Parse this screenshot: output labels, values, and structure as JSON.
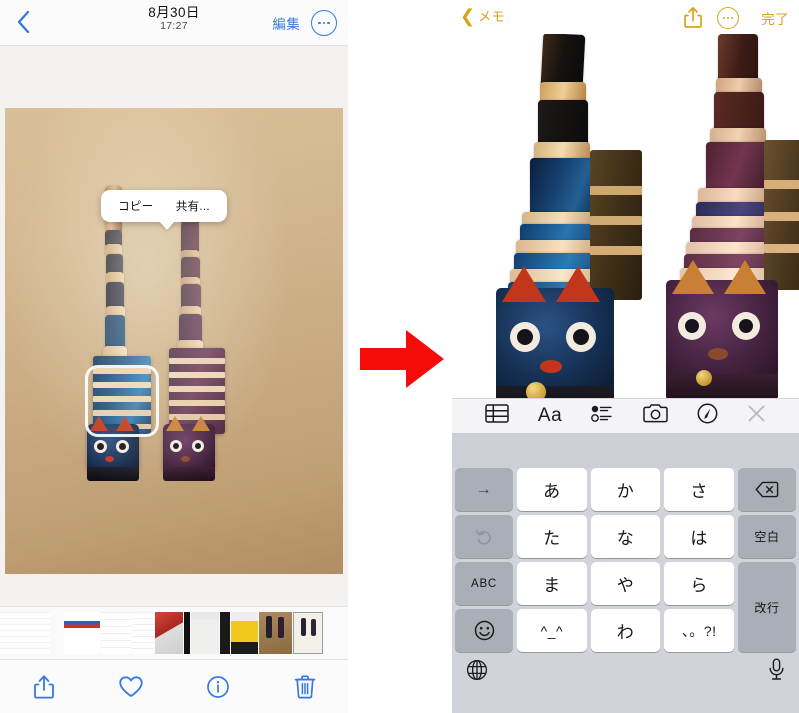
{
  "meta": {
    "description": "Two iPhone screenshots side by side showing copying a photo subject in Photos and pasting it into Notes",
    "accent_blue": "#3478e8",
    "accent_gold": "#d9a21b",
    "arrow_color": "#f60b0b"
  },
  "left_phone": {
    "navbar": {
      "back_icon": "chevron-left-icon",
      "date": "8月30日",
      "time": "17:27",
      "edit_label": "編集",
      "more_icon": "ellipsis-circle-icon"
    },
    "photo": {
      "alt": "Two striped wooden cat figurines standing on a light wood floor",
      "callout": {
        "copy_label": "コピー",
        "share_label": "共有..."
      }
    },
    "filmstrip": {
      "thumbnails": [
        {
          "name": "thumb-notes-grid"
        },
        {
          "name": "thumb-document-white"
        },
        {
          "name": "thumb-chart-red-blue"
        },
        {
          "name": "thumb-list-white"
        },
        {
          "name": "thumb-red-jacket"
        },
        {
          "name": "thumb-white-wall"
        },
        {
          "name": "thumb-yellow-jacket"
        },
        {
          "name": "thumb-cats-photo"
        },
        {
          "name": "thumb-cats-photo-selected"
        }
      ]
    },
    "tabbar": {
      "items": [
        {
          "name": "share-icon",
          "label": "share"
        },
        {
          "name": "heart-icon",
          "label": "favorite"
        },
        {
          "name": "info-icon",
          "label": "info"
        },
        {
          "name": "trash-icon",
          "label": "delete"
        }
      ]
    }
  },
  "right_phone": {
    "navbar": {
      "back_icon": "chevron-left-icon",
      "back_label": "メモ",
      "share_icon": "share-icon",
      "more_icon": "ellipsis-circle-icon",
      "done_label": "完了"
    },
    "note": {
      "alt": "The two wooden cat figurines cut out from their background on white",
      "caret_visible": true
    },
    "keyboard": {
      "toolbar": [
        {
          "name": "table-icon",
          "label": "table"
        },
        {
          "name": "text-format-icon",
          "label": "Aa"
        },
        {
          "name": "checklist-icon",
          "label": "checklist"
        },
        {
          "name": "camera-icon",
          "label": "camera"
        },
        {
          "name": "markup-pen-icon",
          "label": "markup"
        },
        {
          "name": "close-icon",
          "label": "close"
        }
      ],
      "suggestions": [],
      "rows": [
        [
          {
            "label": "→",
            "style": "grey",
            "kind": "fn",
            "name": "cursor-right-key"
          },
          {
            "label": "あ",
            "style": "white",
            "kind": "kana",
            "name": "key-a"
          },
          {
            "label": "か",
            "style": "white",
            "kind": "kana",
            "name": "key-ka"
          },
          {
            "label": "さ",
            "style": "white",
            "kind": "kana",
            "name": "key-sa"
          },
          {
            "label": "⌫",
            "style": "grey",
            "kind": "fn",
            "name": "backspace-key"
          }
        ],
        [
          {
            "label": "↺",
            "style": "grey",
            "kind": "fn",
            "name": "undo-key"
          },
          {
            "label": "た",
            "style": "white",
            "kind": "kana",
            "name": "key-ta"
          },
          {
            "label": "な",
            "style": "white",
            "kind": "kana",
            "name": "key-na"
          },
          {
            "label": "は",
            "style": "white",
            "kind": "kana",
            "name": "key-ha"
          },
          {
            "label": "空白",
            "style": "grey",
            "kind": "kanji",
            "name": "space-key"
          }
        ],
        [
          {
            "label": "ABC",
            "style": "grey",
            "kind": "fn",
            "name": "abc-key"
          },
          {
            "label": "ま",
            "style": "white",
            "kind": "kana",
            "name": "key-ma"
          },
          {
            "label": "や",
            "style": "white",
            "kind": "kana",
            "name": "key-ya"
          },
          {
            "label": "ら",
            "style": "white",
            "kind": "kana",
            "name": "key-ra"
          },
          {
            "label": "改行",
            "style": "grey",
            "kind": "kanji",
            "name": "return-key"
          }
        ],
        [
          {
            "label": "☺",
            "style": "grey",
            "kind": "fn",
            "name": "emoji-key"
          },
          {
            "label": "^_^",
            "style": "white",
            "kind": "kana",
            "name": "kaomoji-key"
          },
          {
            "label": "わ",
            "style": "white",
            "kind": "kana",
            "name": "key-wa"
          },
          {
            "label": "、。?!",
            "style": "white",
            "kind": "punct",
            "name": "punctuation-key"
          }
        ]
      ],
      "bottom": {
        "globe_icon": "globe-icon",
        "mic_icon": "microphone-icon"
      }
    }
  },
  "arrow": {
    "name": "red-right-arrow",
    "direction": "right"
  }
}
